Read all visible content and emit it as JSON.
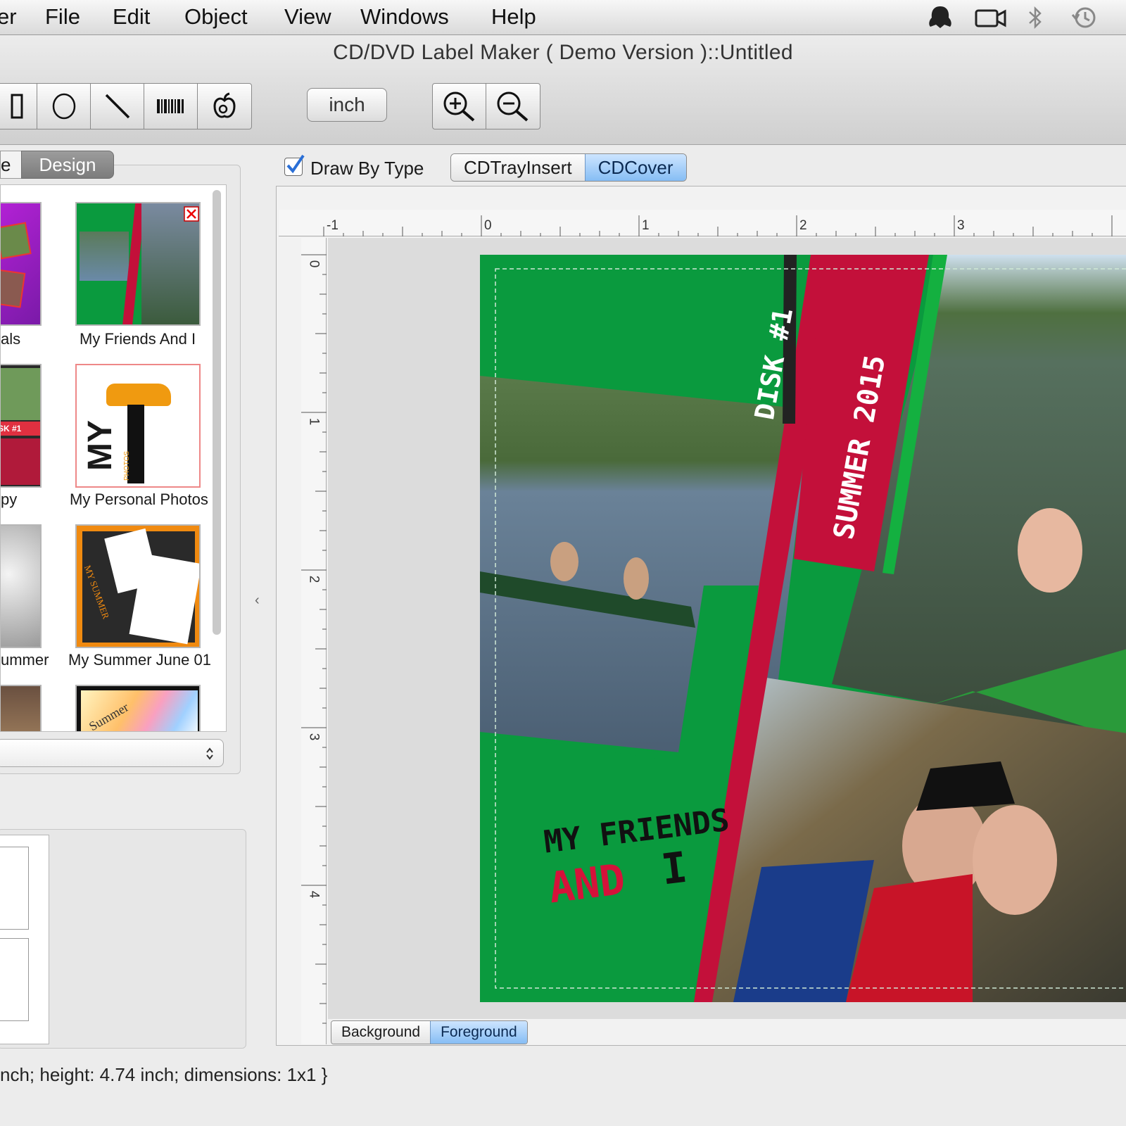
{
  "menu": {
    "app_fragment": "er",
    "items": [
      "File",
      "Edit",
      "Object",
      "View",
      "Windows",
      "Help"
    ]
  },
  "status_icons": [
    "alien-icon",
    "camera-icon",
    "bluetooth-icon",
    "time-machine-icon"
  ],
  "window": {
    "title": "CD/DVD Label Maker ( Demo Version )::Untitled"
  },
  "toolbar": {
    "tools": [
      "rectangle-icon",
      "ellipse-icon",
      "line-icon",
      "barcode-icon",
      "apple-icon"
    ],
    "unit_label": "inch",
    "zoom": [
      "zoom-in-icon",
      "zoom-out-icon"
    ]
  },
  "left_panel": {
    "tab_partial": "e",
    "tab_design": "Design",
    "templates": [
      {
        "label": "als"
      },
      {
        "label": "My Friends And I"
      },
      {
        "label": "py"
      },
      {
        "label": "My Personal Photos"
      },
      {
        "label": "ummer"
      },
      {
        "label": "My Summer June 01"
      }
    ],
    "thumb_text": {
      "disk": "SK #1",
      "my": "MY",
      "photos": "PHOTOS",
      "my_summer": "MY SUMMER",
      "summer": "Summer"
    }
  },
  "design": {
    "draw_by_type_label": "Draw By Type",
    "draw_by_type_checked": true,
    "types": [
      {
        "label": "CDTrayInsert",
        "active": false
      },
      {
        "label": "CDCover",
        "active": true
      }
    ],
    "ruler_h": [
      "-1",
      "0",
      "1",
      "2",
      "3"
    ],
    "ruler_v": [
      "0",
      "1",
      "2",
      "3",
      "4"
    ],
    "label": {
      "disk": "DISK #1",
      "summer": "SUMMER 2015",
      "line1": "MY FRIENDS",
      "line2a": "AND",
      "line2b": "I"
    },
    "layers": [
      {
        "label": "Background",
        "active": false
      },
      {
        "label": "Foreground",
        "active": true
      }
    ]
  },
  "status": {
    "text": "nch; height: 4.74 inch; dimensions: 1x1 }"
  },
  "colors": {
    "label_green": "#0a9a3e",
    "label_red": "#c3103a",
    "accent_blue": "#86bdf4"
  }
}
